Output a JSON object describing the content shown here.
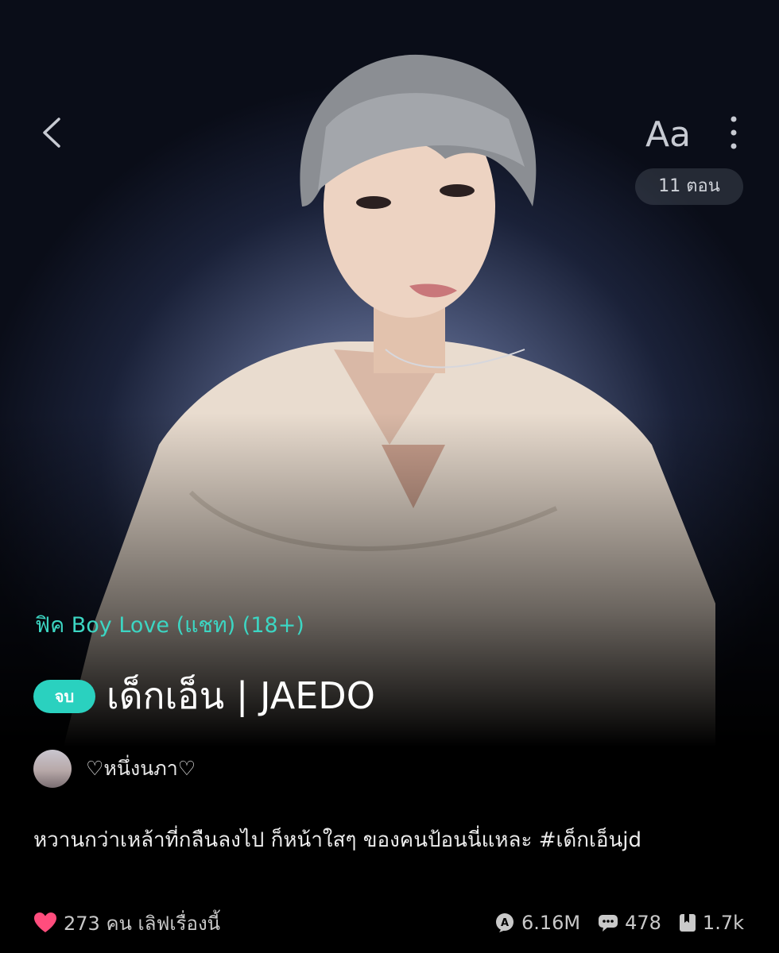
{
  "header": {
    "font_size_label": "Aa",
    "episodes_badge": "11 ตอน"
  },
  "story": {
    "genre": "ฟิค Boy Love (แชท) (18+)",
    "status": "จบ",
    "title": "เด็กเอ็น | JAEDO",
    "author": "♡หนึ่งนภา♡",
    "description": "หวานกว่าเหล้าที่กลืนลงไป ก็หน้าใสๆ ของคนป้อนนี่แหละ #เด็กเอ็นjd"
  },
  "footer": {
    "likes": "273 คน เลิฟเรื่องนี้",
    "views": "6.16M",
    "comments": "478",
    "saves": "1.7k"
  },
  "colors": {
    "accent": "#2ad1bf",
    "genre": "#3cd6c3",
    "heart": "#ff4d7d"
  },
  "icons": [
    "back-chevron-icon",
    "font-size-icon",
    "more-vertical-icon",
    "heart-icon",
    "views-icon",
    "comment-icon",
    "bookmark-icon"
  ]
}
